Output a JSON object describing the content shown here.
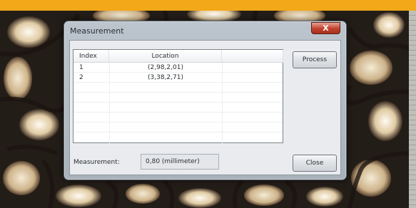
{
  "dialog": {
    "title": "Measurement",
    "close_glyph": "X"
  },
  "list": {
    "columns": [
      "Index",
      "Location",
      ""
    ],
    "rows": [
      {
        "index": "1",
        "location": "(2,98,2,01)"
      },
      {
        "index": "2",
        "location": "(3,38,2,71)"
      }
    ]
  },
  "buttons": {
    "process": "Process",
    "close": "Close"
  },
  "measurement": {
    "label": "Measurement:",
    "value": "0,80 (millimeter)"
  },
  "colors": {
    "top_bar": "#f2a818",
    "close_button": "#c0412c"
  },
  "icons": {
    "close": "close-icon"
  }
}
